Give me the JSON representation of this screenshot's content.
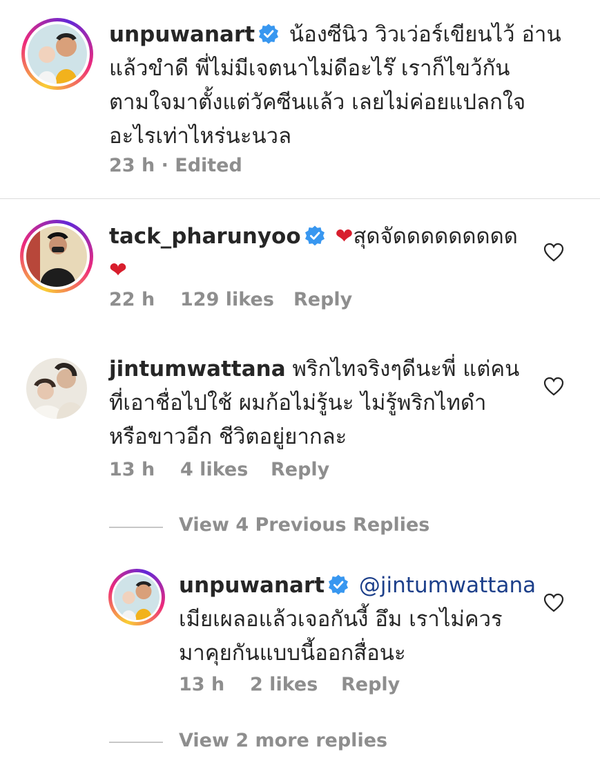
{
  "comments": [
    {
      "username": "unpuwanart",
      "text_lines": [
        "น้องซีนิว วิวเว่อร์เขียนไว้ อ่าน",
        "แล้วขำดี พี่ไม่มีเจตนาไม่ดีอะไร๊ เราก็ไขว้กัน",
        "ตามใจมาตั้งแต่วัคซีนแล้ว เลยไม่ค่อยแปลกใจ",
        "อะไรเท่าไหร่นะนวล"
      ],
      "time": "23 h · Edited"
    },
    {
      "username": "tack_pharunyoo",
      "text_lines": [
        "สุดจัดดดดดดดดด",
        ""
      ],
      "heart_start": "❤",
      "heart_end": "❤",
      "time": "22 h",
      "likes": "129 likes",
      "reply": "Reply"
    },
    {
      "username": "jintumwattana",
      "text_lines": [
        "พริกไทจริงๆดีนะพี่ แต่คน",
        "ที่เอาชื่อไปใช้ ผมก้อไม่รู้นะ ไม่รู้พริกไทดำ",
        "หรือขาวอีก ชีวิตอยู่ยากละ"
      ],
      "time": "13 h",
      "likes": "4 likes",
      "reply": "Reply"
    }
  ],
  "view_previous": "View 4 Previous Replies",
  "reply_comment": {
    "username": "unpuwanart",
    "mention": "@jintumwattana",
    "text_lines": [
      "เมียเผลอแล้วเจอกันงี้ อึม เราไม่ควร",
      "มาคุยกันแบบนี้ออกสื่อนะ"
    ],
    "time": "13 h",
    "likes": "2 likes",
    "reply": "Reply"
  },
  "view_more": "View 2 more replies",
  "colors": {
    "text": "#262626",
    "muted": "#8e8e8e",
    "verified": "#3897f0",
    "heart": "#d81e2d",
    "mention": "#1c3f8a"
  }
}
